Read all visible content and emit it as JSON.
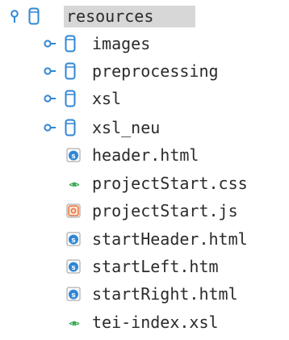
{
  "colors": {
    "folder": "#2f86d6",
    "html": "#2f86d6",
    "css": "#3aa853",
    "js": "#e8743b",
    "selection": "#d7d7d7"
  },
  "tree": {
    "root": {
      "label": "resources",
      "icon": "folder-icon",
      "expanded": true,
      "selected": true
    },
    "folders": [
      {
        "label": "images",
        "icon": "folder-icon",
        "expanded": false
      },
      {
        "label": "preprocessing",
        "icon": "folder-icon",
        "expanded": false
      },
      {
        "label": "xsl",
        "icon": "folder-icon",
        "expanded": false
      },
      {
        "label": "xsl_neu",
        "icon": "folder-icon",
        "expanded": false
      }
    ],
    "files": [
      {
        "label": "header.html",
        "icon": "html-file-icon"
      },
      {
        "label": "projectStart.css",
        "icon": "css-file-icon"
      },
      {
        "label": "projectStart.js",
        "icon": "js-file-icon"
      },
      {
        "label": "startHeader.html",
        "icon": "html-file-icon"
      },
      {
        "label": "startLeft.htm",
        "icon": "html-file-icon"
      },
      {
        "label": "startRight.html",
        "icon": "html-file-icon"
      },
      {
        "label": "tei-index.xsl",
        "icon": "xsl-file-icon"
      }
    ]
  }
}
